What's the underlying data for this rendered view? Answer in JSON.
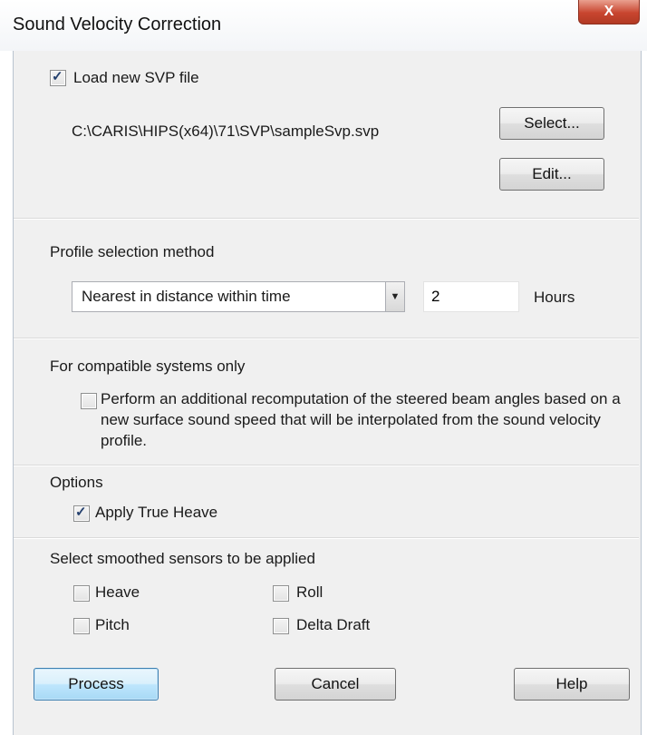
{
  "window": {
    "title": "Sound Velocity Correction",
    "close_label": "X"
  },
  "svp": {
    "load_label": "Load new SVP file",
    "load_checked": true,
    "file_path": "C:\\CARIS\\HIPS(x64)\\71\\SVP\\sampleSvp.svp",
    "select_label": "Select...",
    "edit_label": "Edit..."
  },
  "profile": {
    "heading": "Profile selection method",
    "method_value": "Nearest in distance within time",
    "hours_value": "2",
    "hours_label": "Hours"
  },
  "compatible": {
    "heading": "For compatible systems only",
    "recompute_label": "Perform an additional recomputation of the steered beam angles based on a new surface sound speed that will be interpolated from the sound velocity profile.",
    "recompute_checked": false
  },
  "options": {
    "heading": "Options",
    "true_heave_label": "Apply True Heave",
    "true_heave_checked": true
  },
  "sensors": {
    "heading": "Select smoothed sensors to be applied",
    "heave_label": "Heave",
    "roll_label": "Roll",
    "pitch_label": "Pitch",
    "delta_draft_label": "Delta Draft",
    "heave_checked": false,
    "roll_checked": false,
    "pitch_checked": false,
    "delta_draft_checked": false
  },
  "actions": {
    "process_label": "Process",
    "cancel_label": "Cancel",
    "help_label": "Help"
  }
}
